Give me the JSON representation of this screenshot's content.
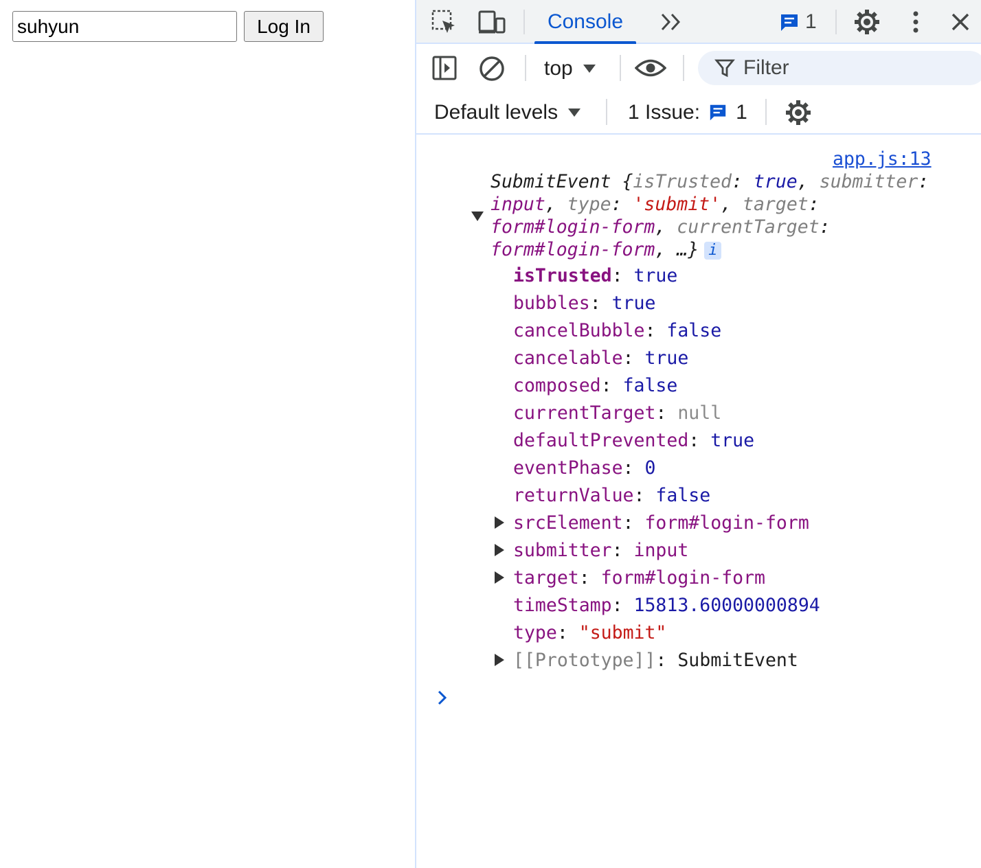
{
  "page": {
    "username_value": "suhyun",
    "login_button_label": "Log In"
  },
  "devtools": {
    "tabs": {
      "console_label": "Console",
      "issues_badge_count": "1"
    },
    "toolbar": {
      "context_label": "top",
      "filter_placeholder": "Filter",
      "levels_label": "Default levels",
      "issues_label": "1 Issue:",
      "issues_count": "1"
    },
    "colors": {
      "accent": "#0b57d0",
      "tabbar_bg": "#f1f3f4",
      "border": "#d3e3fd",
      "prop_name": "#881280",
      "prop_value": "#1a1aa6",
      "string_value": "#c41a16"
    },
    "icons": {
      "inspect": "inspect-element-icon",
      "device": "device-toolbar-icon",
      "more_tabs": "more-tabs-chevron-icon",
      "issues": "message-icon",
      "settings": "gear-icon",
      "menu": "kebab-menu-icon",
      "close": "close-icon",
      "sidebar": "sidebar-toggle-icon",
      "clear": "clear-console-icon",
      "eye": "live-expression-eye-icon",
      "filter": "filter-funnel-icon",
      "prompt": "console-prompt-chevron-icon"
    },
    "console": {
      "source_link": "app.js:13",
      "summary": {
        "l1_name": "SubmitEvent",
        "l1_open": " {",
        "l1_k1": "isTrusted",
        "l1_c1": ": ",
        "l1_v1": "true",
        "l1_sep": ", ",
        "l1_k2": "submitter",
        "l1_c2": ":",
        "l2_v2": "input",
        "l2_sep": ", ",
        "l2_k3": "type",
        "l2_c3": ": ",
        "l2_v3": "'submit'",
        "l2_sep2": ", ",
        "l2_k4": "target",
        "l2_c4": ":",
        "l3_v4": "form#login-form",
        "l3_sep": ", ",
        "l3_k5": "currentTarget",
        "l3_c5": ":",
        "l4_v5": "form#login-form",
        "l4_end": ", …}",
        "info_badge": "i"
      },
      "properties": [
        {
          "name": "isTrusted",
          "value": "true"
        },
        {
          "name": "bubbles",
          "value": "true"
        },
        {
          "name": "cancelBubble",
          "value": "false"
        },
        {
          "name": "cancelable",
          "value": "true"
        },
        {
          "name": "composed",
          "value": "false"
        },
        {
          "name": "currentTarget",
          "value": "null"
        },
        {
          "name": "defaultPrevented",
          "value": "true"
        },
        {
          "name": "eventPhase",
          "value": "0"
        },
        {
          "name": "returnValue",
          "value": "false"
        },
        {
          "name": "srcElement",
          "value": "form#login-form"
        },
        {
          "name": "submitter",
          "value": "input"
        },
        {
          "name": "target",
          "value": "form#login-form"
        },
        {
          "name": "timeStamp",
          "value": "15813.60000000894"
        },
        {
          "name": "type",
          "value": "\"submit\""
        },
        {
          "name": "[[Prototype]]",
          "value": "SubmitEvent"
        }
      ],
      "colon": ": "
    }
  }
}
